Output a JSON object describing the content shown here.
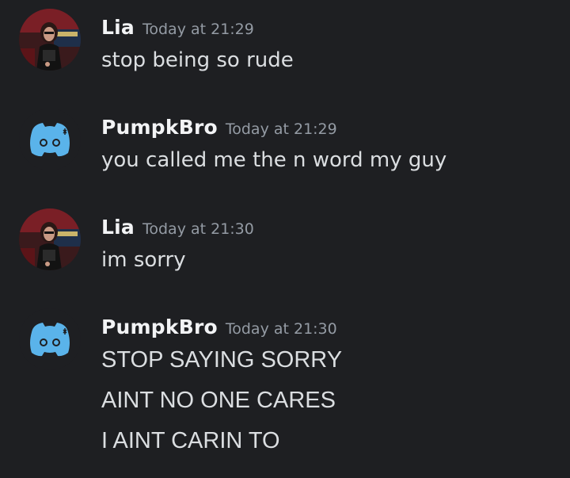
{
  "messages": [
    {
      "username": "Lia",
      "timestamp": "Today at 21:29",
      "avatar_icon": "user-photo-avatar",
      "lines": [
        "stop being so rude"
      ]
    },
    {
      "username": "PumpkBro",
      "timestamp": "Today at 21:29",
      "avatar_icon": "discord-default-avatar",
      "lines": [
        "you called me the n word my guy"
      ]
    },
    {
      "username": "Lia",
      "timestamp": "Today at 21:30",
      "avatar_icon": "user-photo-avatar",
      "lines": [
        "im sorry"
      ]
    },
    {
      "username": "PumpkBro",
      "timestamp": "Today at 21:30",
      "avatar_icon": "discord-default-avatar",
      "lines": [
        "STOP SAYING SORRY",
        "AINT NO ONE CARES",
        "I AINT CARIN TO"
      ]
    }
  ],
  "colors": {
    "background": "#1e1f22",
    "username": "#f2f3f5",
    "timestamp": "#949ba4",
    "message_text": "#dbdee1",
    "discord_blurple_avatar": "#5ab3ea"
  }
}
